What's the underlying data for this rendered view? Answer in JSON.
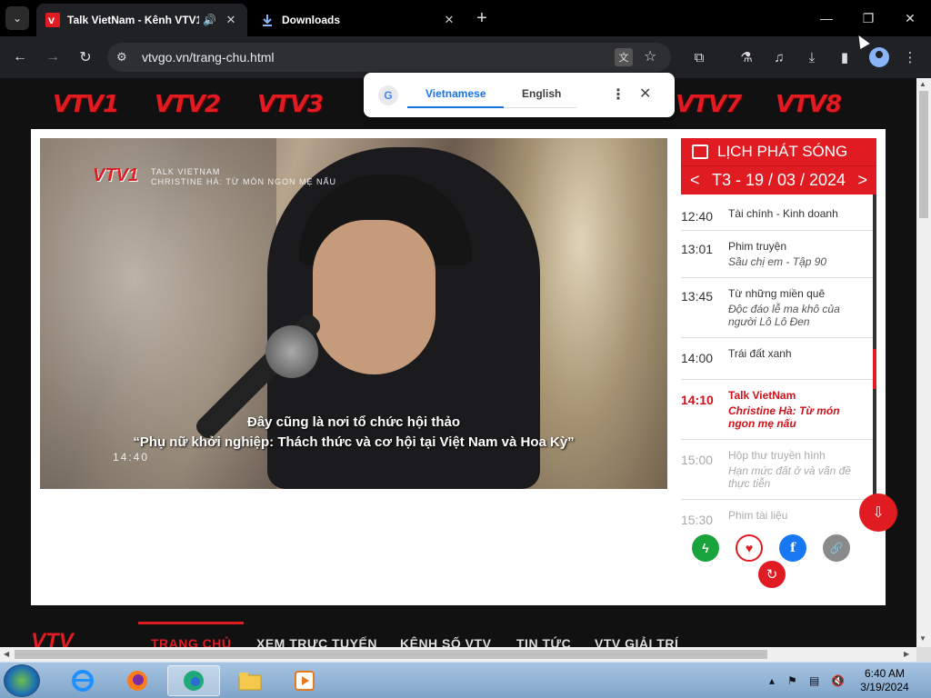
{
  "browser": {
    "tabs": [
      {
        "title": "Talk VietNam - Kênh VTV1,",
        "audio": "🔊",
        "close": "✕"
      },
      {
        "title": "Downloads",
        "close": "✕"
      }
    ],
    "new_tab": "+",
    "window": {
      "minimize": "—",
      "restore": "❐",
      "close": "✕"
    },
    "nav": {
      "back": "←",
      "forward": "→",
      "reload": "↻"
    },
    "url": "vtvgo.vn/trang-chu.html",
    "translate_icon": "文",
    "star": "☆"
  },
  "translate_popup": {
    "logo": "G",
    "languages": [
      "Vietnamese",
      "English"
    ],
    "more": "⋮",
    "close": "✕"
  },
  "channels": [
    "VTV1",
    "VTV2",
    "VTV3",
    "VTV7",
    "VTV8"
  ],
  "video": {
    "logo": "VTV1",
    "tag_line1": "TALK VIETNAM",
    "tag_line2": "CHRISTINE HÀ: TỪ MÓN NGON MẸ NẤU",
    "subtitle1": "Đây cũng là nơi tổ chức hội thảo",
    "subtitle2": "“Phụ nữ khởi nghiệp: Thách thức và cơ hội tại Việt Nam và Hoa Kỳ”",
    "clock": "14:40"
  },
  "schedule": {
    "title": "LỊCH PHÁT SÓNG",
    "prev": "<",
    "next": ">",
    "date": "T3 - 19 / 03 / 2024",
    "items": [
      {
        "time": "12:40",
        "title": "Tài chính - Kinh doanh",
        "sub": ""
      },
      {
        "time": "13:01",
        "title": "Phim truyện",
        "sub": "Sầu chị em - Tập 90"
      },
      {
        "time": "13:45",
        "title": "Từ những miền quê",
        "sub": "Độc đáo lễ ma khô của người Lô Lô Đen"
      },
      {
        "time": "14:00",
        "title": "Trái đất xanh",
        "sub": ""
      },
      {
        "time": "14:10",
        "title": "Talk VietNam",
        "sub": "Christine Hà: Từ món ngon mẹ nấu"
      },
      {
        "time": "15:00",
        "title": "Hộp thư truyền hình",
        "sub": "Hạn mức đất ở và vấn đề thực tiễn"
      },
      {
        "time": "15:30",
        "title": "Phim tài liệu",
        "sub": ""
      }
    ]
  },
  "share": {
    "flash": "ϟ",
    "heart": "♥",
    "facebook": "f",
    "link": "🔗",
    "replay": "↻",
    "mouse": "⇩"
  },
  "bottom_nav": {
    "logo": "VTV",
    "items": [
      "TRANG CHỦ",
      "XEM TRỰC TUYẾN",
      "KÊNH SỐ VTV",
      "TIN TỨC",
      "VTV GIẢI TRÍ"
    ]
  },
  "taskbar": {
    "clock_time": "6:40 AM",
    "clock_date": "3/19/2024"
  },
  "colors": {
    "accent": "#e11b22",
    "chrome": "#202124"
  }
}
